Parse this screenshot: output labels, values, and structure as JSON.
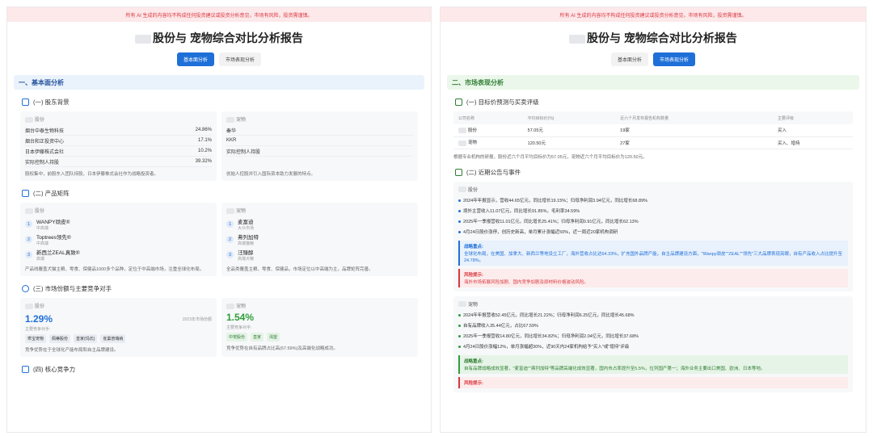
{
  "disclaimer": "所有 AI 生成的内容均不构成任何投资建议或投资分析意见，市场有风险，投资需谨慎。",
  "title": "股份与 宠物综合对比分析报告",
  "tabs": [
    "基本面分析",
    "市场表现分析"
  ],
  "left": {
    "section": "一、基本面分析",
    "shareholders": {
      "heading": "(一) 股东背景",
      "a": {
        "name": "股份",
        "rows": [
          {
            "label": "烟台中泰生物科技",
            "value": "24.86%"
          },
          {
            "label": "烟台和正投资中心",
            "value": "17.1%"
          },
          {
            "label": "日本伊藤株式会社",
            "value": "10.2%"
          },
          {
            "label": "实际控制人持股",
            "value": "39.32%"
          }
        ],
        "note": "股权集中，前股东入团队持股，日本伊藤株式会社作为战略投资者。"
      },
      "b": {
        "name": "宠物",
        "rows": [
          {
            "label": "秦华",
            "value": ""
          },
          {
            "label": "KKR",
            "value": ""
          },
          {
            "label": "实际控制人持股",
            "value": ""
          }
        ],
        "note": "创始人控股并引入国际资本助力发展的特点。"
      }
    },
    "products": {
      "heading": "(二) 产品矩阵",
      "a": {
        "name": "股份",
        "items": [
          {
            "n": "1",
            "name": "WANPY顽皮®",
            "sub": "中高端"
          },
          {
            "n": "2",
            "name": "Toptrees领先®",
            "sub": "中高端"
          },
          {
            "n": "3",
            "name": "新西兰ZEAL真致®",
            "sub": "高端"
          }
        ],
        "note": "产品线覆盖犬猫主粮、零食、保健品1000多个品种，定位于中高端市场，注重全球化布局。"
      },
      "b": {
        "name": "宠物",
        "items": [
          {
            "n": "1",
            "name": "麦富迪",
            "sub": "大众市场"
          },
          {
            "n": "2",
            "name": "弗列加特",
            "sub": "高端猫粮"
          },
          {
            "n": "3",
            "name": "汪臻醇",
            "sub": "高端犬粮"
          }
        ],
        "note": "全品类覆盖主粮、零食、保健品，市场定位以中高端为主，品牌矩阵完善。"
      }
    },
    "market": {
      "heading": "(三) 市场份额与主要竞争对手",
      "a": {
        "name": "股份",
        "share": "1.29%",
        "year_note": "2023年市场份额",
        "competitors_label": "主要竞争对手:",
        "competitors": [
          "乖宝宠物",
          "佩蒂股份",
          "皇家(玛氏)",
          "雀巢普瑞纳"
        ],
        "note": "竞争优势在于全球化产能布局和自主品牌建设。"
      },
      "b": {
        "name": "宠物",
        "share": "1.54%",
        "competitors_label": "主要竞争对手:",
        "competitors": [
          "中宠股份",
          "皇家",
          "渴望"
        ],
        "note": "竞争优势在自有品牌占比高(67.59%)及高端化战略成功。"
      }
    },
    "core": {
      "heading": "(四) 核心竞争力"
    }
  },
  "right": {
    "section": "二、市场表现分析",
    "ratings": {
      "heading": "(一) 目标价预测与买卖评级",
      "headers": [
        "公司名称",
        "平均目标价(%)",
        "近六个月发布报告机构数量",
        "主要评级"
      ],
      "rows": [
        [
          "股份",
          "57.05元",
          "19家",
          "买入"
        ],
        [
          "宠物",
          "120.50元",
          "27家",
          "买入、增持"
        ]
      ],
      "note": "根据专业机构的研报，股份近六个月平均目标价为57.05元，宠物近六个月平均目标价为120.50元。"
    },
    "events": {
      "heading": "(二) 近期公告与事件",
      "a": {
        "name": "股份",
        "items": [
          "2024年年报显示，营收44.65亿元，同比增长19.15%；归母净利润3.94亿元，同比增长68.89%",
          "境外主营收入11.07亿元，同比增长91.85%，毛利率34.59%",
          "2025年一季报营收11.01亿元，同比增长25.41%；归母净利润0.91亿元，同比增长62.13%",
          "4月24日股价涨停，创历史新高，单月累计涨幅近50%，近一周近20家机构调研"
        ],
        "strategy_label": "战略重点:",
        "strategy": "全球化布局，在美国、加拿大、新西兰等地设立工厂，海外营收占比达64.33%，扩充国外品牌产能，自主品牌建设方面，\"Wanpy顽皮\"\"ZEAL\"\"领先\"三大品牌表现亮眼，自有产品收入占比提升至24.78%。",
        "risk_label": "风险提示:",
        "risk": "海外市场拓展风险加剧、国内竞争加剧及原材料价格波动风险。"
      },
      "b": {
        "name": "宠物",
        "items": [
          "2024年年报营收52.45亿元，同比增长21.22%；归母净利润6.25亿元，同比增长45.68%",
          "自有品牌收入35.44亿元，占比67.59%",
          "2025年一季报营收14.80亿元，同比增长34.82%；归母净利润2.04亿元，同比增长37.68%",
          "4月24日股价涨幅12%，单月涨幅超30%，近90天内24家机构给予\"买入\"或\"增持\"评级"
        ],
        "strategy_label": "战略重点:",
        "strategy": "自有品牌战略成效显著，\"麦富迪\"\"弗列加特\"等品牌高端化成效显著，国内市占率提升至5.5%，位列国产第一；海外业务主要出口美国、欧洲、日本等地。",
        "risk_label": "风险提示:"
      }
    }
  }
}
